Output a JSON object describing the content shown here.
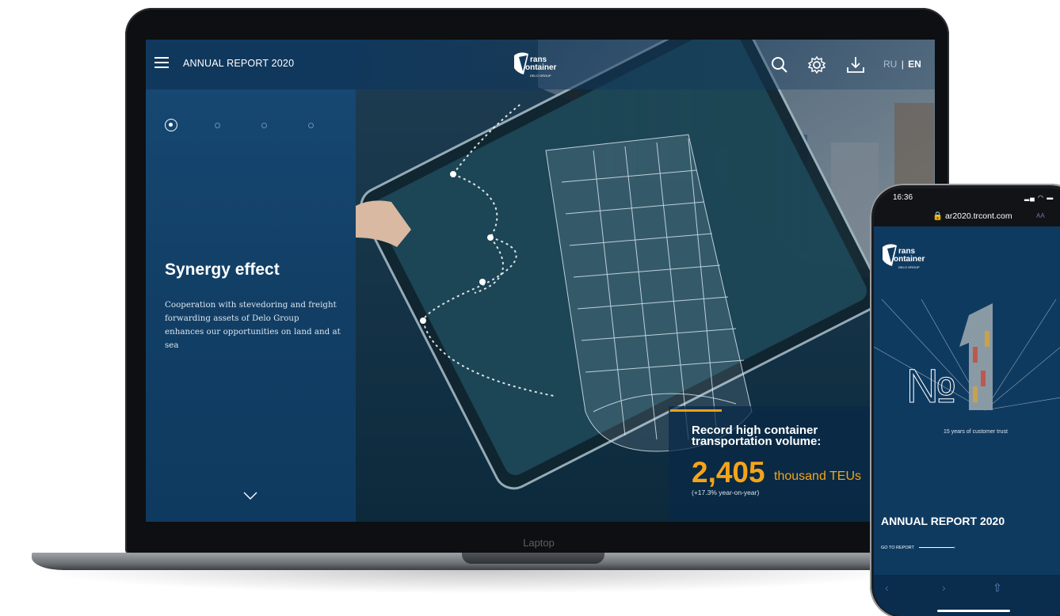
{
  "laptop": {
    "label": "Laptop",
    "header": {
      "menu_icon": "hamburger-menu-icon",
      "title": "ANNUAL REPORT 2020",
      "logo_line1": "rans",
      "logo_line2": "ontainer",
      "logo_sub": "DELO GROUP",
      "icons": [
        "search-icon",
        "settings-gear-icon",
        "download-icon"
      ],
      "lang_ru": "RU",
      "lang_sep": "|",
      "lang_en": "EN"
    },
    "slider": {
      "dots": 4,
      "active_index": 0,
      "heading": "Synergy effect",
      "text": "Cooperation with stevedoring and freight forwarding assets of Delo Group enhances our opportunities on land and at sea",
      "scroll_icon": "chevron-down-icon"
    },
    "record": {
      "title": "Record high container transportation volume:",
      "value": "2,405",
      "unit": "thousand TEUs",
      "note": "(+17.3% year-on-year)"
    }
  },
  "phone": {
    "time": "16:36",
    "url": "ar2020.trcont.com",
    "aa": "AA",
    "logo_line1": "rans",
    "logo_line2": "ontainer",
    "logo_sub": "DELO GROUP",
    "tagline": "15 years of customer trust",
    "title": "ANNUAL REPORT 2020",
    "go_to_report": "GO TO REPORT",
    "nav": [
      "back-icon",
      "forward-icon",
      "share-icon"
    ]
  },
  "colors": {
    "navy": "#0f3a60",
    "accent_orange": "#f5a418"
  }
}
